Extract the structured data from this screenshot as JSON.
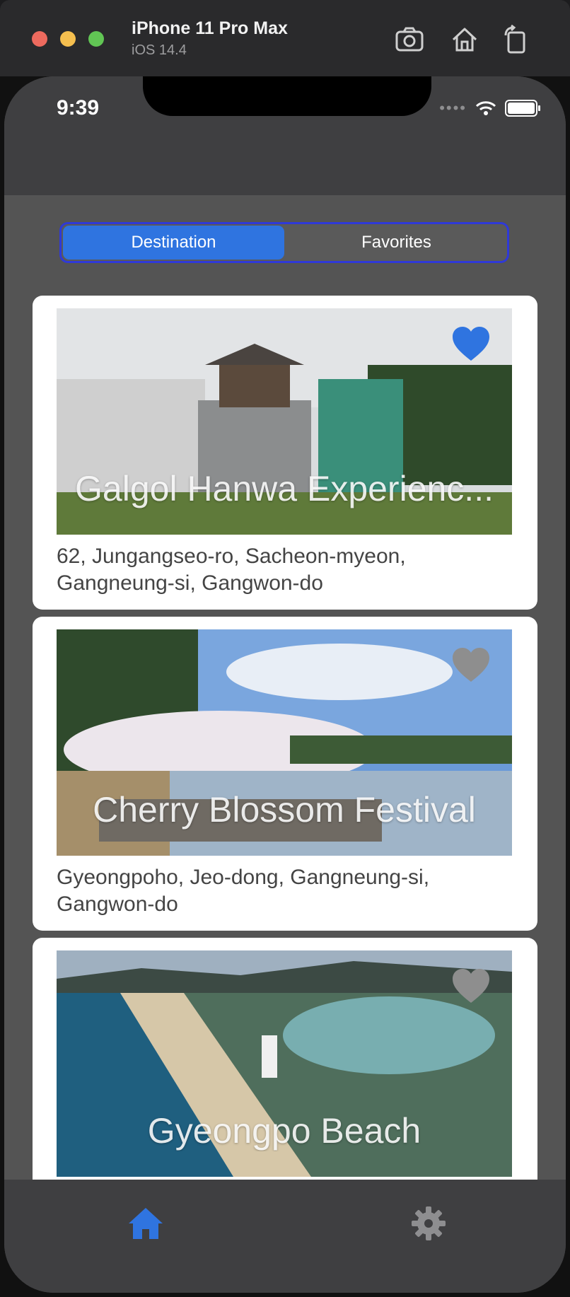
{
  "simulator": {
    "device_name": "iPhone 11 Pro Max",
    "os_version": "iOS 14.4",
    "buttons": [
      "screenshot-icon",
      "home-icon",
      "rotate-icon"
    ]
  },
  "status_bar": {
    "time": "9:39"
  },
  "segment": {
    "tabs": [
      {
        "label": "Destination",
        "selected": true
      },
      {
        "label": "Favorites",
        "selected": false
      }
    ],
    "accent_color": "#2f74e0"
  },
  "cards": [
    {
      "title": "Galgol Hanwa Experienc...",
      "address": "62, Jungangseo-ro, Sacheon-myeon, Gangneung-si, Gangwon-do",
      "favorite": true
    },
    {
      "title": "Cherry Blossom Festival",
      "address": "Gyeongpoho, Jeo-dong, Gangneung-si, Gangwon-do",
      "favorite": false
    },
    {
      "title": "Gyeongpo Beach",
      "address": "",
      "favorite": false
    }
  ],
  "tab_bar": {
    "items": [
      {
        "icon": "home-icon",
        "active": true
      },
      {
        "icon": "gear-icon",
        "active": false
      }
    ]
  },
  "colors": {
    "favorite_on": "#2f74e0",
    "favorite_off": "#8e8e8e",
    "tab_active": "#2f74e0",
    "tab_inactive": "#8e8e90"
  }
}
